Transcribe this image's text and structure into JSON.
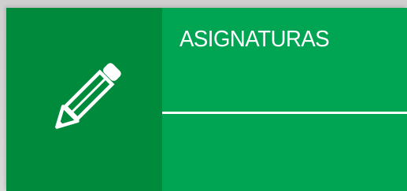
{
  "tile": {
    "title": "ASIGNATURAS",
    "icon": "pencil-icon",
    "colors": {
      "icon_panel": "#008a3c",
      "content_panel": "#00a553",
      "foreground": "#ffffff"
    }
  }
}
